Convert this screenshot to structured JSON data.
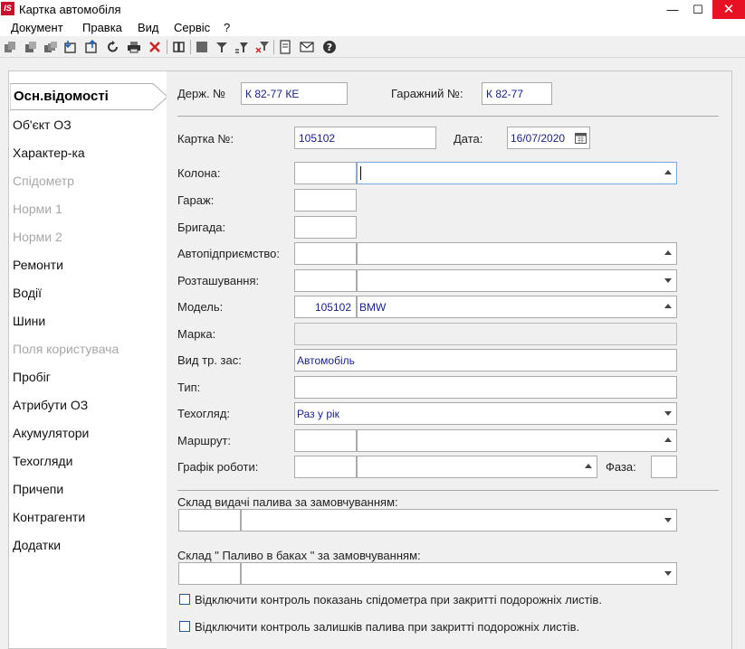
{
  "window": {
    "title": "Картка автомобіля",
    "app_icon_text": "IS",
    "minimize_label": "—",
    "maximize_label": "☐",
    "close_label": "✕"
  },
  "menu": [
    "Документ",
    "Правка",
    "Вид",
    "Сервіс",
    "?"
  ],
  "toolbar_icons": [
    "copy-icon",
    "copy-alt-icon",
    "copy-multi-icon",
    "import-icon",
    "export-icon",
    "refresh-icon",
    "print-icon",
    "delete-icon",
    "book-icon",
    "stop-icon",
    "filter-icon",
    "filter-edit-icon",
    "filter-clear-icon",
    "document-icon",
    "mail-icon",
    "help-icon"
  ],
  "nav": {
    "active": "Осн.відомості",
    "items": [
      {
        "label": "Об'єкт ОЗ",
        "disabled": false
      },
      {
        "label": "Характер-ка",
        "disabled": false
      },
      {
        "label": "Спідометр",
        "disabled": true
      },
      {
        "label": "Норми 1",
        "disabled": true
      },
      {
        "label": "Норми 2",
        "disabled": true
      },
      {
        "label": "Ремонти",
        "disabled": false
      },
      {
        "label": "Водії",
        "disabled": false
      },
      {
        "label": "Шини",
        "disabled": false
      },
      {
        "label": "Поля користувача",
        "disabled": true
      },
      {
        "label": "Пробіг",
        "disabled": false
      },
      {
        "label": "Атрибути ОЗ",
        "disabled": false
      },
      {
        "label": "Акумулятори",
        "disabled": false
      },
      {
        "label": "Техогляди",
        "disabled": false
      },
      {
        "label": "Причепи",
        "disabled": false
      },
      {
        "label": "Контрагенти",
        "disabled": false
      },
      {
        "label": "Додатки",
        "disabled": false
      }
    ]
  },
  "form": {
    "reg_number_label": "Держ. №",
    "reg_number_value": "К 82-77 КЕ",
    "garage_number_label": "Гаражний №:",
    "garage_number_value": "К 82-77",
    "card_number_label": "Картка №:",
    "card_number_value": "105102",
    "date_label": "Дата:",
    "date_value": "16/07/2020",
    "column_label": "Колона:",
    "column_code": "",
    "column_name": "",
    "garage_label": "Гараж:",
    "garage_value": "",
    "brigade_label": "Бригада:",
    "brigade_value": "",
    "enterprise_label": "Автопідприємство:",
    "enterprise_code": "",
    "enterprise_name": "",
    "location_label": "Розташування:",
    "location_code": "",
    "location_name": "",
    "model_label": "Модель:",
    "model_code": "105102",
    "model_name": "BMW",
    "brand_label": "Марка:",
    "brand_value": "",
    "vehicle_type_label": "Вид тр. зас:",
    "vehicle_type_value": "Автомобіль",
    "type_label": "Тип:",
    "type_value": "",
    "inspection_label": "Техогляд:",
    "inspection_value": "Раз у рік",
    "route_label": "Маршрут:",
    "route_code": "",
    "route_name": "",
    "schedule_label": "Графік роботи:",
    "schedule_code": "",
    "schedule_name": "",
    "phase_label": "Фаза:",
    "phase_value": "",
    "fuel_warehouse_label": "Склад видачі палива за замовчуванням:",
    "fuel_warehouse_code": "",
    "fuel_warehouse_name": "",
    "tank_warehouse_label": "Склад \" Паливо в баках \" за замовчуванням:",
    "tank_warehouse_code": "",
    "tank_warehouse_name": "",
    "check_speedometer_label": "Відключити контроль показань спідометра при закритті подорожніх листів.",
    "check_speedometer_checked": false,
    "check_fuel_label": "Відключити контроль залишків палива при закритті подорожніх листів.",
    "check_fuel_checked": false
  }
}
